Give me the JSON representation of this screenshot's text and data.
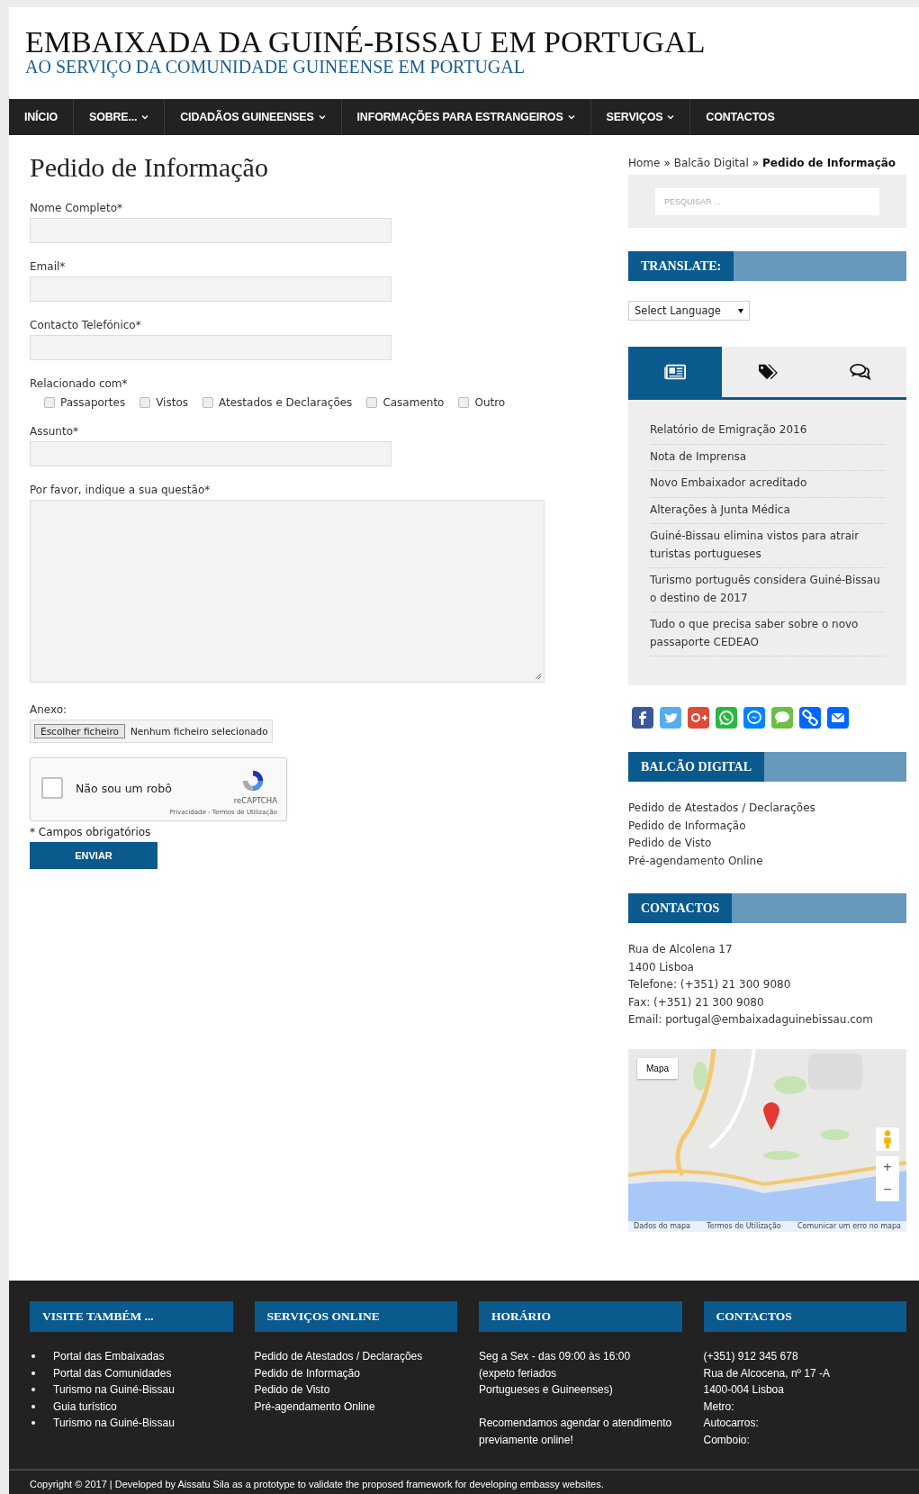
{
  "header": {
    "title": "EMBAIXADA DA GUINÉ-BISSAU EM PORTUGAL",
    "subtitle": "AO SERVIÇO DA COMUNIDADE GUINEENSE EM PORTUGAL"
  },
  "nav": [
    {
      "label": "INÍCIO",
      "dropdown": false
    },
    {
      "label": "SOBRE...",
      "dropdown": true
    },
    {
      "label": "CIDADÃOS GUINEENSES",
      "dropdown": true
    },
    {
      "label": "INFORMAÇÕES PARA ESTRANGEIROS",
      "dropdown": true
    },
    {
      "label": "SERVIÇOS",
      "dropdown": true
    },
    {
      "label": "CONTACTOS",
      "dropdown": false
    }
  ],
  "page_title": "Pedido de Informação",
  "form": {
    "fields": [
      {
        "kind": "text",
        "label": "Nome Completo*"
      },
      {
        "kind": "text",
        "label": "Email*"
      },
      {
        "kind": "text",
        "label": "Contacto Telefónico*"
      },
      {
        "kind": "checkboxes",
        "label": "Relacionado com*",
        "options": [
          {
            "label": "Passaportes",
            "checked": false
          },
          {
            "label": "Vistos",
            "checked": false
          },
          {
            "label": "Atestados e Declarações",
            "checked": false
          },
          {
            "label": "Casamento",
            "checked": false
          },
          {
            "label": "Outro",
            "checked": false
          }
        ]
      },
      {
        "kind": "text",
        "label": "Assunto*"
      },
      {
        "kind": "textarea",
        "label": "Por favor, indique a sua questão*"
      },
      {
        "kind": "file",
        "label": "Anexo:",
        "button": "Escolher ficheiro",
        "status": "Nenhum ficheiro selecionado"
      }
    ],
    "captcha": {
      "label": "Não sou um robô",
      "checked": false,
      "brand": "reCAPTCHA",
      "links": "Privacidade - Termos de Utilização"
    },
    "required_note": "* Campos obrigatórios",
    "submit": "ENVIAR"
  },
  "sidebar": {
    "breadcrumb": [
      {
        "label": "Home",
        "current": false
      },
      {
        "label": "Balcão Digital",
        "current": false
      },
      {
        "label": "Pedido de Informação",
        "current": true
      }
    ],
    "separator": "»",
    "search": {
      "placeholder": "PESQUISAR ..."
    },
    "translate": {
      "title": "TRANSLATE:",
      "select": "Select Language"
    },
    "tabs": [
      {
        "kind": "news",
        "selected": true
      },
      {
        "kind": "tags",
        "selected": false
      },
      {
        "kind": "comments",
        "selected": false
      }
    ],
    "posts": [
      "Relatório de Emigração 2016",
      "Nota de Imprensa",
      "Novo Embaixador acreditado",
      "Alterações à Junta Médica",
      "Guiné-Bissau elimina vistos para atrair turistas portugueses",
      "Turismo português considera Guiné-Bissau o destino de 2017",
      "Tudo o que precisa saber sobre o novo passaporte CEDEAO"
    ],
    "share": [
      {
        "kind": "facebook",
        "color": "#3b5998"
      },
      {
        "kind": "twitter",
        "color": "#55acee"
      },
      {
        "kind": "googleplus",
        "color": "#dd4b39"
      },
      {
        "kind": "whatsapp",
        "color": "#2cb742"
      },
      {
        "kind": "messenger",
        "color": "#0084ff"
      },
      {
        "kind": "sms",
        "color": "#6cbe45"
      },
      {
        "kind": "link",
        "color": "#0166ff"
      },
      {
        "kind": "email",
        "color": "#0166ff"
      }
    ],
    "balcao": {
      "title": "BALCÃO DIGITAL",
      "links": [
        "Pedido de Atestados / Declarações",
        "Pedido de Informação",
        "Pedido de Visto",
        "Pré-agendamento Online"
      ]
    },
    "contactos": {
      "title": "CONTACTOS",
      "lines": [
        "Rua de Alcolena 17",
        "1400 Lisboa",
        "Telefone: (+351) 21 300 9080",
        "Fax: (+351) 21 300 9080",
        "Email: portugal@embaixadaguinebissau.com"
      ]
    },
    "map": {
      "kind": "picture",
      "button": "Mapa",
      "zoom_in": "+",
      "zoom_out": "−",
      "attribution": [
        "Dados do mapa",
        "Termos de Utilização",
        "Comunicar um erro no mapa"
      ]
    }
  },
  "footer": {
    "columns": [
      {
        "title": "VISITE TAMBÉM ...",
        "kind": "bullets",
        "items": [
          "Portal das Embaixadas",
          "Portal das Comunidades",
          "Turismo na Guiné-Bissau",
          "Guia turístico",
          "Turismo na Guiné-Bissau"
        ]
      },
      {
        "title": "SERVIÇOS ONLINE",
        "kind": "links",
        "items": [
          "Pedido de Atestados / Declarações",
          "Pedido de Informação",
          "Pedido de Visto",
          "Pré-agendamento Online"
        ]
      },
      {
        "title": "HORÁRIO",
        "kind": "paragraphs",
        "items": [
          [
            "Seg a Sex - das 09:00 às 16:00",
            "(expeto feriados",
            "Portugueses e Guineenses)"
          ],
          [
            "Recomendamos agendar o atendimento",
            "previamente online!"
          ]
        ]
      },
      {
        "title": "CONTACTOS",
        "kind": "lines",
        "items": [
          "(+351) 912 345 678",
          "Rua de Alcocena, nº 17 -A",
          "1400-004 Lisboa",
          "Metro:",
          "Autocarros:",
          "Comboio:"
        ]
      }
    ],
    "copyright": "Copyright © 2017 | Developed by Aissatu Sila as a prototype to validate the proposed framework for developing embassy websites."
  }
}
